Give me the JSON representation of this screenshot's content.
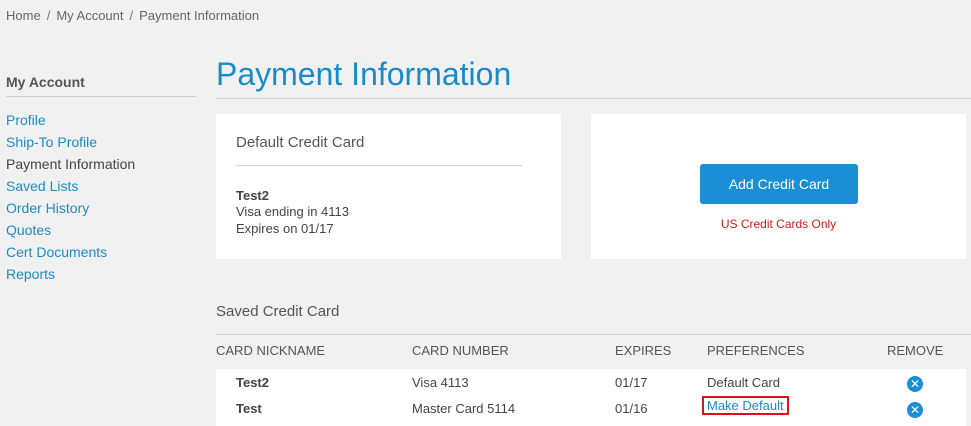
{
  "breadcrumb": {
    "items": [
      "Home",
      "My Account",
      "Payment Information"
    ],
    "separator": "/"
  },
  "sidebar": {
    "title": "My Account",
    "items": [
      {
        "label": "Profile"
      },
      {
        "label": "Ship-To Profile"
      },
      {
        "label": "Payment Information"
      },
      {
        "label": "Saved Lists"
      },
      {
        "label": "Order History"
      },
      {
        "label": "Quotes"
      },
      {
        "label": "Cert Documents"
      },
      {
        "label": "Reports"
      }
    ]
  },
  "page": {
    "title": "Payment Information"
  },
  "default_card": {
    "heading": "Default Credit Card",
    "nickname": "Test2",
    "line1": "Visa ending in 4113",
    "line2": "Expires on 01/17"
  },
  "add_card": {
    "button_label": "Add Credit Card",
    "note": "US Credit Cards Only"
  },
  "saved": {
    "heading": "Saved Credit Card",
    "columns": [
      "CARD NICKNAME",
      "CARD NUMBER",
      "EXPIRES",
      "PREFERENCES",
      "REMOVE"
    ],
    "rows": [
      {
        "nickname": "Test2",
        "number": "Visa 4113",
        "expires": "01/17",
        "preference": "Default Card"
      },
      {
        "nickname": "Test",
        "number": "Master Card 5114",
        "expires": "01/16",
        "preference": "Make Default"
      }
    ],
    "remove_icon": "close-circle-icon"
  },
  "colors": {
    "accent": "#1a8bc9",
    "button": "#1a8fd6",
    "warning": "#d01c1c",
    "highlight_box": "#d9141c"
  }
}
